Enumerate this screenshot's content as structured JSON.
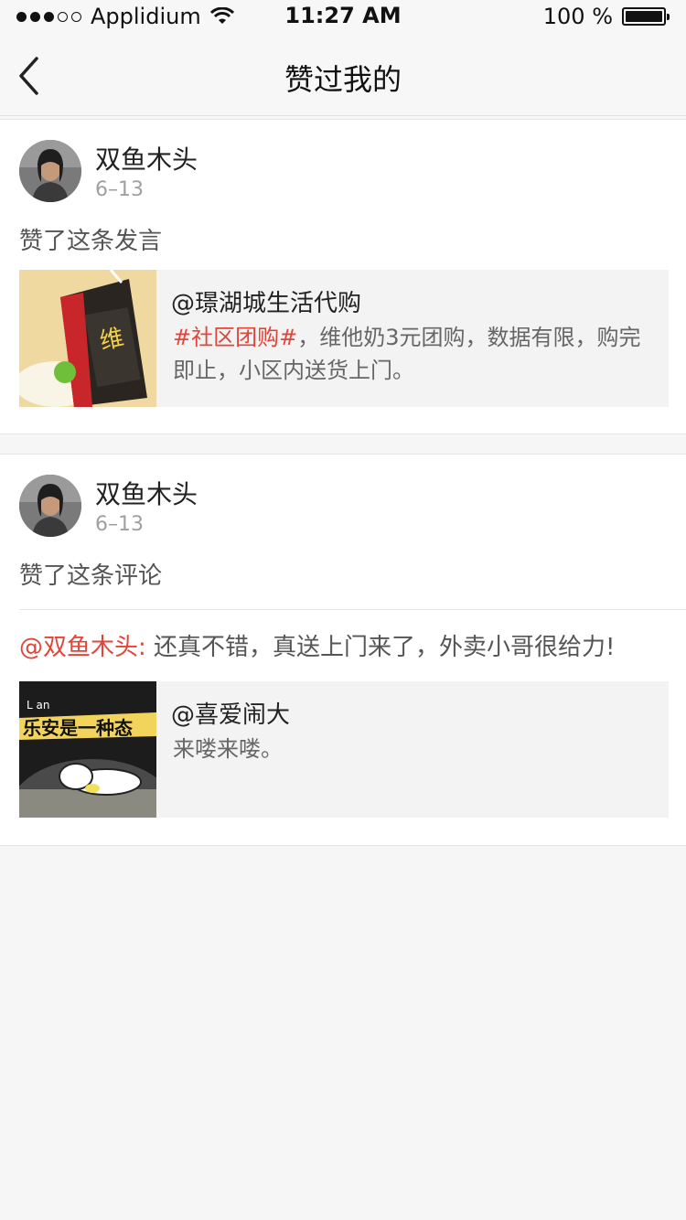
{
  "status_bar": {
    "carrier": "Applidium",
    "time": "11:27 AM",
    "battery": "100 %"
  },
  "nav": {
    "title": "赞过我的"
  },
  "items": [
    {
      "user_name": "双鱼木头",
      "date": "6–13",
      "action": "赞了这条发言",
      "quote_author": "@璟湖城生活代购",
      "quote_tag": "#社区团购#",
      "quote_body": "，维他奶3元团购，数据有限，购完即止，小区内送货上门。"
    },
    {
      "user_name": "双鱼木头",
      "date": "6–13",
      "action": "赞了这条评论",
      "comment_mention": "@双鱼木头:",
      "comment_text": " 还真不错，真送上门来了，外卖小哥很给力!",
      "quote_author": "@喜爱闹大",
      "quote_body": "来喽来喽。",
      "thumb_text": "乐安是一种态",
      "thumb_small": "L an"
    }
  ]
}
